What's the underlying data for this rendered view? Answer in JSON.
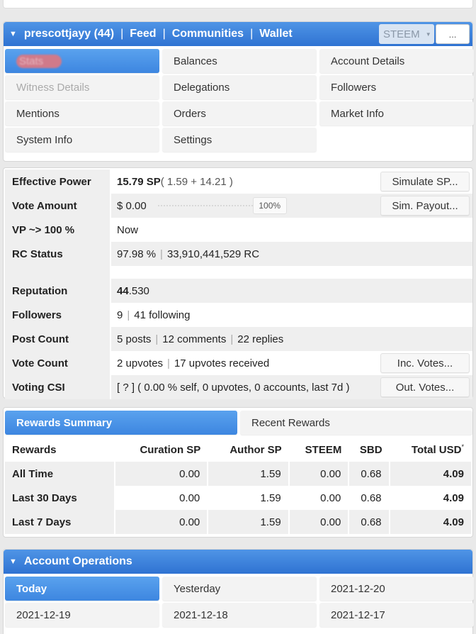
{
  "header": {
    "username": "prescottjayy (44)",
    "nav": [
      "Feed",
      "Communities",
      "Wallet"
    ],
    "currency": "STEEM",
    "more": "..."
  },
  "tabs": [
    {
      "label": "Stats",
      "state": "active-blurred"
    },
    {
      "label": "Balances",
      "state": "normal"
    },
    {
      "label": "Account Details",
      "state": "normal"
    },
    {
      "label": "Witness Details",
      "state": "disabled"
    },
    {
      "label": "Delegations",
      "state": "normal"
    },
    {
      "label": "Followers",
      "state": "normal"
    },
    {
      "label": "Mentions",
      "state": "normal"
    },
    {
      "label": "Orders",
      "state": "normal"
    },
    {
      "label": "Market Info",
      "state": "normal"
    },
    {
      "label": "System Info",
      "state": "normal"
    },
    {
      "label": "Settings",
      "state": "normal"
    }
  ],
  "stats": {
    "effective_power": {
      "label": "Effective Power",
      "value_bold": "15.79 SP",
      "value_rest": " ( 1.59 + 14.21 )",
      "button": "Simulate SP..."
    },
    "vote_amount": {
      "label": "Vote Amount",
      "value": "$ 0.00",
      "slider_pct": "100%",
      "slider_value": 1.0,
      "button": "Sim. Payout..."
    },
    "vp": {
      "label": "VP ~> 100 %",
      "value": "Now"
    },
    "rc": {
      "label": "RC Status",
      "pct": "97.98 %",
      "amount": "33,910,441,529 RC"
    },
    "reputation": {
      "label": "Reputation",
      "int": "44",
      "dec": ".530"
    },
    "followers": {
      "label": "Followers",
      "count": "9",
      "following": "41 following"
    },
    "posts": {
      "label": "Post Count",
      "posts": "5 posts",
      "comments": "12 comments",
      "replies": "22 replies"
    },
    "votes": {
      "label": "Vote Count",
      "up": "2 upvotes",
      "received": "17 upvotes received",
      "button": "Inc. Votes..."
    },
    "csi": {
      "label": "Voting CSI",
      "value": "[ ? ] ( 0.00 % self, 0 upvotes, 0 accounts, last 7d )",
      "button": "Out. Votes..."
    }
  },
  "rewards": {
    "tabs": [
      "Rewards Summary",
      "Recent Rewards"
    ],
    "headers": [
      "Rewards",
      "Curation SP",
      "Author SP",
      "STEEM",
      "SBD",
      "Total USD"
    ],
    "header_star": "*",
    "rows": [
      {
        "period": "All Time",
        "curation": "0.00",
        "author": "1.59",
        "steem": "0.00",
        "sbd": "0.68",
        "total": "4.09"
      },
      {
        "period": "Last 30 Days",
        "curation": "0.00",
        "author": "1.59",
        "steem": "0.00",
        "sbd": "0.68",
        "total": "4.09"
      },
      {
        "period": "Last 7 Days",
        "curation": "0.00",
        "author": "1.59",
        "steem": "0.00",
        "sbd": "0.68",
        "total": "4.09"
      }
    ]
  },
  "operations": {
    "title": "Account Operations",
    "days": [
      "Today",
      "Yesterday",
      "2021-12-20",
      "2021-12-19",
      "2021-12-18",
      "2021-12-17"
    ]
  },
  "colors": {
    "accent": "#3d86e0",
    "shaded": "#efefef"
  }
}
